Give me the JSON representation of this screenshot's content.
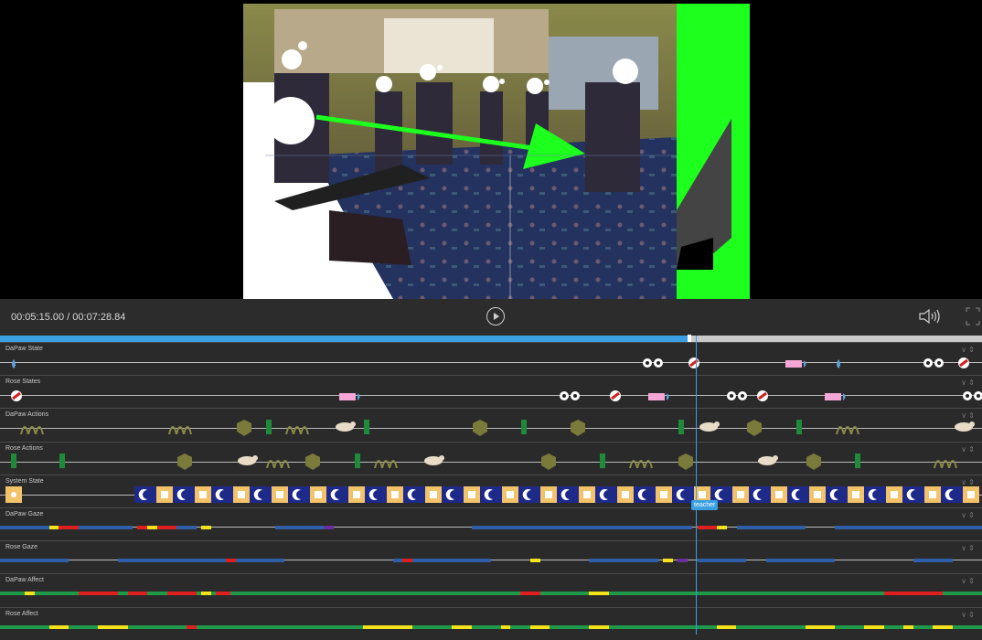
{
  "player": {
    "timecode": "00:05:15.00 / 00:07:28.84",
    "current_time_seconds": 315.0,
    "duration_seconds": 448.84,
    "progress_fraction": 0.702
  },
  "playhead": {
    "tag": "teacher"
  },
  "colors": {
    "accent": "#3aa0e2",
    "green_marker": "#1dff1d",
    "gaze_blue": "#2f5fa8",
    "gaze_red": "#e02020",
    "gaze_yellow": "#f5e21a",
    "gaze_purple": "#6a2ea0",
    "affect_green": "#1f9a4a",
    "affect_red": "#e02020",
    "affect_yellow": "#f5e21a",
    "state_blue": "#1e2a8a",
    "state_yellow": "#f3c36a",
    "action_olive": "#7a7a3a",
    "action_green": "#1f8a3a"
  },
  "tracks": [
    {
      "name": "DaPaw State",
      "kind": "icons",
      "events": [
        {
          "t": 0.01,
          "icon": "droplet-icon"
        },
        {
          "t": 0.655,
          "icon": "eyes-icon"
        },
        {
          "t": 0.7,
          "icon": "capsule-icon"
        },
        {
          "t": 0.8,
          "icon": "pink-tag-icon"
        },
        {
          "t": 0.85,
          "icon": "droplet-icon"
        },
        {
          "t": 0.94,
          "icon": "eyes-icon"
        },
        {
          "t": 0.975,
          "icon": "capsule-icon"
        }
      ]
    },
    {
      "name": "Rose States",
      "kind": "icons",
      "events": [
        {
          "t": 0.01,
          "icon": "capsule-icon"
        },
        {
          "t": 0.345,
          "icon": "pink-tag-icon"
        },
        {
          "t": 0.57,
          "icon": "eyes-icon"
        },
        {
          "t": 0.62,
          "icon": "capsule-icon"
        },
        {
          "t": 0.66,
          "icon": "pink-tag-icon"
        },
        {
          "t": 0.74,
          "icon": "eyes-icon"
        },
        {
          "t": 0.77,
          "icon": "capsule-icon"
        },
        {
          "t": 0.84,
          "icon": "pink-tag-icon"
        },
        {
          "t": 0.98,
          "icon": "eyes-icon"
        }
      ]
    },
    {
      "name": "DaPaw Actions",
      "kind": "actions",
      "events": [
        {
          "t": 0.02,
          "icon": "sprout-icon"
        },
        {
          "t": 0.17,
          "icon": "sprout-icon"
        },
        {
          "t": 0.24,
          "icon": "hexagon-icon"
        },
        {
          "t": 0.27,
          "icon": "bar-icon"
        },
        {
          "t": 0.29,
          "icon": "sprout-icon"
        },
        {
          "t": 0.34,
          "icon": "creature-icon"
        },
        {
          "t": 0.37,
          "icon": "bar-icon"
        },
        {
          "t": 0.48,
          "icon": "hexagon-icon"
        },
        {
          "t": 0.53,
          "icon": "bar-icon"
        },
        {
          "t": 0.58,
          "icon": "hexagon-icon"
        },
        {
          "t": 0.69,
          "icon": "bar-icon"
        },
        {
          "t": 0.71,
          "icon": "creature-icon"
        },
        {
          "t": 0.76,
          "icon": "hexagon-icon"
        },
        {
          "t": 0.81,
          "icon": "bar-icon"
        },
        {
          "t": 0.85,
          "icon": "sprout-icon"
        },
        {
          "t": 0.97,
          "icon": "creature-icon"
        }
      ]
    },
    {
      "name": "Rose Actions",
      "kind": "actions",
      "events": [
        {
          "t": 0.01,
          "icon": "bar-icon"
        },
        {
          "t": 0.06,
          "icon": "bar-icon"
        },
        {
          "t": 0.18,
          "icon": "hexagon-icon"
        },
        {
          "t": 0.24,
          "icon": "creature-icon"
        },
        {
          "t": 0.27,
          "icon": "sprout-icon"
        },
        {
          "t": 0.31,
          "icon": "hexagon-icon"
        },
        {
          "t": 0.36,
          "icon": "bar-icon"
        },
        {
          "t": 0.38,
          "icon": "sprout-icon"
        },
        {
          "t": 0.43,
          "icon": "creature-icon"
        },
        {
          "t": 0.55,
          "icon": "hexagon-icon"
        },
        {
          "t": 0.61,
          "icon": "bar-icon"
        },
        {
          "t": 0.64,
          "icon": "sprout-icon"
        },
        {
          "t": 0.69,
          "icon": "hexagon-icon"
        },
        {
          "t": 0.77,
          "icon": "creature-icon"
        },
        {
          "t": 0.82,
          "icon": "hexagon-icon"
        },
        {
          "t": 0.87,
          "icon": "bar-icon"
        },
        {
          "t": 0.95,
          "icon": "sprout-icon"
        }
      ]
    },
    {
      "name": "System State",
      "kind": "system",
      "events": []
    },
    {
      "name": "DaPaw Gaze",
      "kind": "segments",
      "segments": [
        {
          "start": 0.0,
          "end": 0.05,
          "color": "#2f5fa8"
        },
        {
          "start": 0.05,
          "end": 0.06,
          "color": "#f5e21a"
        },
        {
          "start": 0.06,
          "end": 0.08,
          "color": "#e02020"
        },
        {
          "start": 0.08,
          "end": 0.135,
          "color": "#2f5fa8"
        },
        {
          "start": 0.14,
          "end": 0.15,
          "color": "#e02020"
        },
        {
          "start": 0.15,
          "end": 0.16,
          "color": "#f5e21a"
        },
        {
          "start": 0.16,
          "end": 0.18,
          "color": "#e02020"
        },
        {
          "start": 0.18,
          "end": 0.2,
          "color": "#2f5fa8"
        },
        {
          "start": 0.205,
          "end": 0.215,
          "color": "#f5e21a"
        },
        {
          "start": 0.28,
          "end": 0.33,
          "color": "#2f5fa8"
        },
        {
          "start": 0.33,
          "end": 0.34,
          "color": "#6a2ea0"
        },
        {
          "start": 0.48,
          "end": 0.66,
          "color": "#2f5fa8"
        },
        {
          "start": 0.66,
          "end": 0.705,
          "color": "#2f5fa8"
        },
        {
          "start": 0.71,
          "end": 0.73,
          "color": "#e02020"
        },
        {
          "start": 0.73,
          "end": 0.74,
          "color": "#f5e21a"
        },
        {
          "start": 0.75,
          "end": 0.82,
          "color": "#2f5fa8"
        },
        {
          "start": 0.85,
          "end": 0.97,
          "color": "#2f5fa8"
        },
        {
          "start": 0.97,
          "end": 1.0,
          "color": "#2f5fa8"
        }
      ]
    },
    {
      "name": "Rose Gaze",
      "kind": "segments",
      "segments": [
        {
          "start": 0.0,
          "end": 0.07,
          "color": "#2f5fa8"
        },
        {
          "start": 0.12,
          "end": 0.23,
          "color": "#2f5fa8"
        },
        {
          "start": 0.23,
          "end": 0.24,
          "color": "#e02020"
        },
        {
          "start": 0.24,
          "end": 0.29,
          "color": "#2f5fa8"
        },
        {
          "start": 0.4,
          "end": 0.41,
          "color": "#2f5fa8"
        },
        {
          "start": 0.41,
          "end": 0.42,
          "color": "#e02020"
        },
        {
          "start": 0.42,
          "end": 0.5,
          "color": "#2f5fa8"
        },
        {
          "start": 0.54,
          "end": 0.55,
          "color": "#f5e21a"
        },
        {
          "start": 0.6,
          "end": 0.67,
          "color": "#2f5fa8"
        },
        {
          "start": 0.675,
          "end": 0.685,
          "color": "#f5e21a"
        },
        {
          "start": 0.69,
          "end": 0.7,
          "color": "#6a2ea0"
        },
        {
          "start": 0.71,
          "end": 0.76,
          "color": "#2f5fa8"
        },
        {
          "start": 0.78,
          "end": 0.85,
          "color": "#2f5fa8"
        },
        {
          "start": 0.93,
          "end": 0.97,
          "color": "#2f5fa8"
        }
      ]
    },
    {
      "name": "DaPaw Affect",
      "kind": "segments",
      "segments": [
        {
          "start": 0.0,
          "end": 1.0,
          "color": "#1f9a4a"
        },
        {
          "start": 0.025,
          "end": 0.035,
          "color": "#f5e21a"
        },
        {
          "start": 0.08,
          "end": 0.12,
          "color": "#e02020"
        },
        {
          "start": 0.13,
          "end": 0.15,
          "color": "#e02020"
        },
        {
          "start": 0.17,
          "end": 0.2,
          "color": "#e02020"
        },
        {
          "start": 0.205,
          "end": 0.215,
          "color": "#f5e21a"
        },
        {
          "start": 0.22,
          "end": 0.235,
          "color": "#e02020"
        },
        {
          "start": 0.53,
          "end": 0.55,
          "color": "#e02020"
        },
        {
          "start": 0.6,
          "end": 0.62,
          "color": "#f5e21a"
        },
        {
          "start": 0.9,
          "end": 0.96,
          "color": "#e02020"
        }
      ]
    },
    {
      "name": "Rose Affect",
      "kind": "segments",
      "segments": [
        {
          "start": 0.0,
          "end": 1.0,
          "color": "#1f9a4a"
        },
        {
          "start": 0.05,
          "end": 0.07,
          "color": "#f5e21a"
        },
        {
          "start": 0.1,
          "end": 0.13,
          "color": "#f5e21a"
        },
        {
          "start": 0.19,
          "end": 0.2,
          "color": "#e02020"
        },
        {
          "start": 0.37,
          "end": 0.42,
          "color": "#f5e21a"
        },
        {
          "start": 0.46,
          "end": 0.48,
          "color": "#f5e21a"
        },
        {
          "start": 0.51,
          "end": 0.52,
          "color": "#f5e21a"
        },
        {
          "start": 0.54,
          "end": 0.56,
          "color": "#f5e21a"
        },
        {
          "start": 0.6,
          "end": 0.62,
          "color": "#f5e21a"
        },
        {
          "start": 0.73,
          "end": 0.75,
          "color": "#f5e21a"
        },
        {
          "start": 0.82,
          "end": 0.85,
          "color": "#f5e21a"
        },
        {
          "start": 0.88,
          "end": 0.9,
          "color": "#f5e21a"
        },
        {
          "start": 0.92,
          "end": 0.93,
          "color": "#f5e21a"
        },
        {
          "start": 0.95,
          "end": 0.97,
          "color": "#f5e21a"
        }
      ]
    }
  ]
}
